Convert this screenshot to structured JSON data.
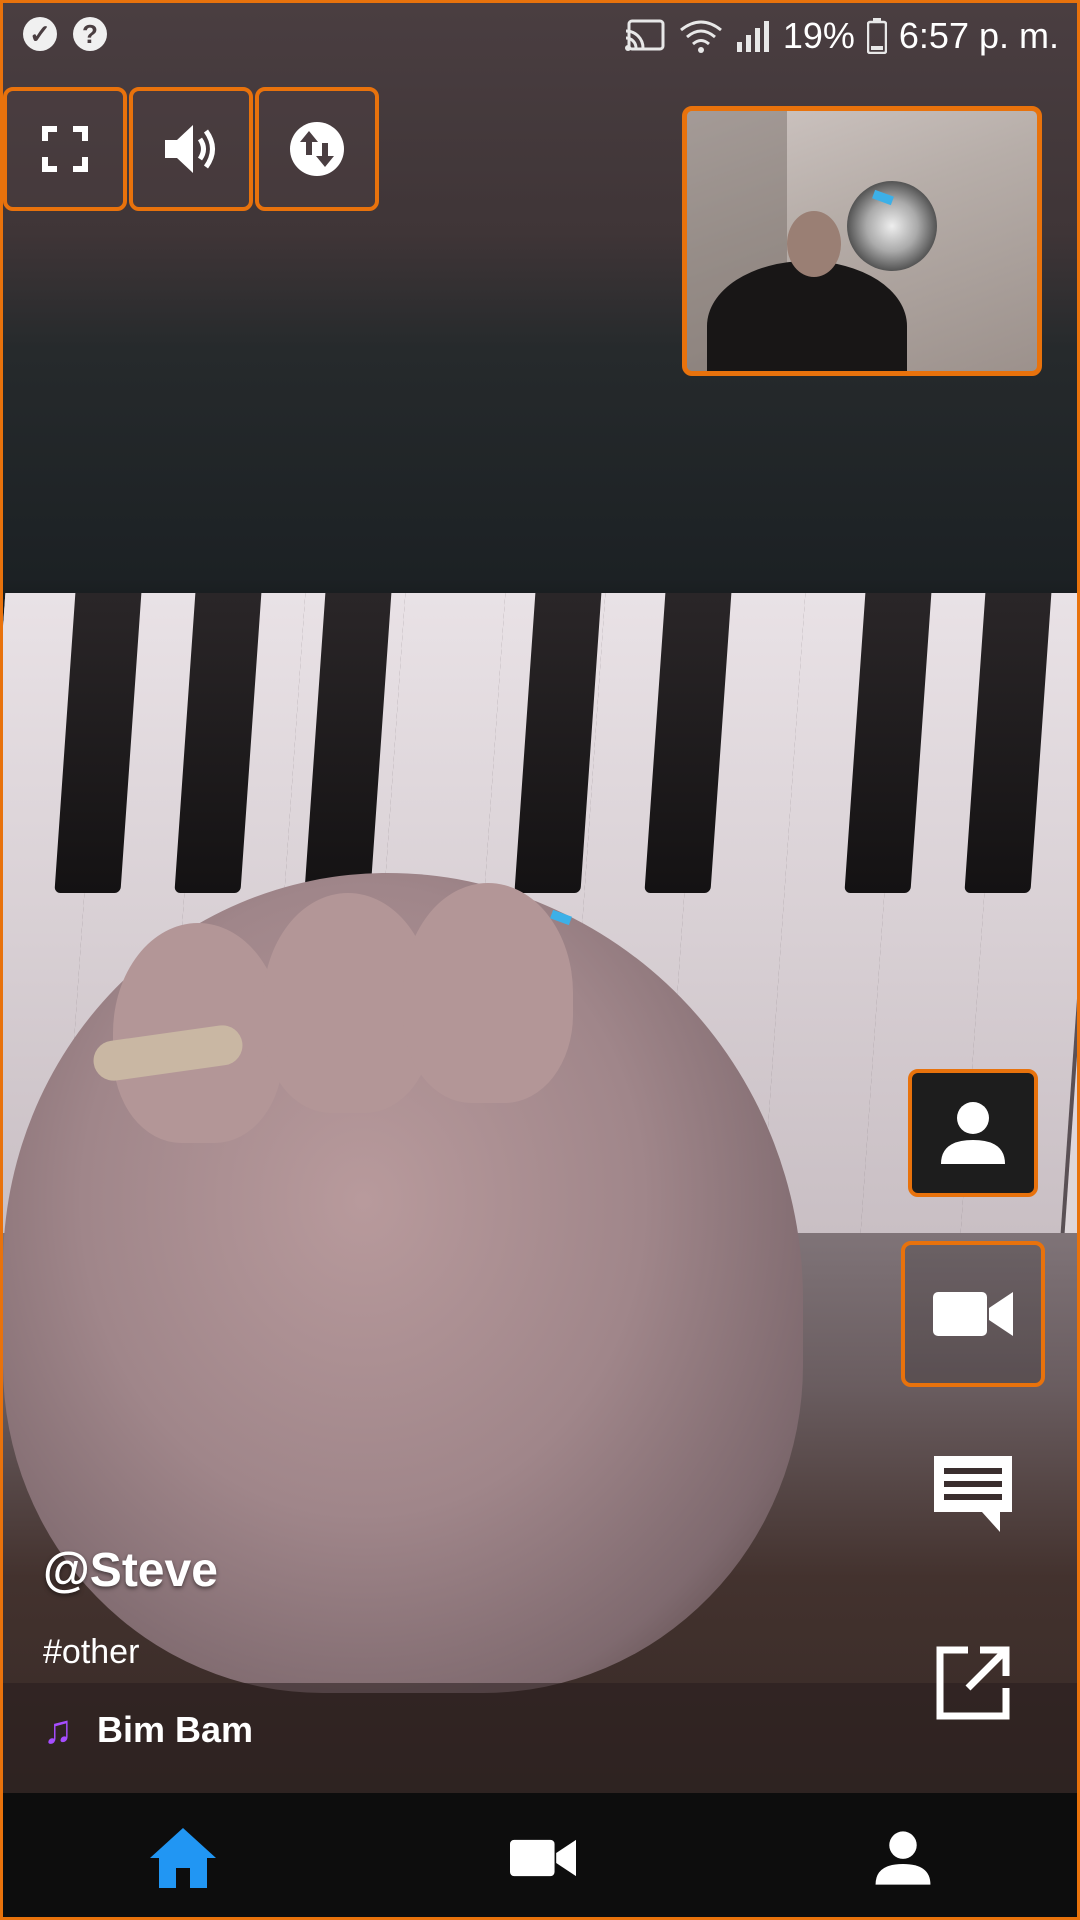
{
  "status_bar": {
    "icons_left": [
      "check-circle-icon",
      "help-circle-icon"
    ],
    "icons_right": [
      "cast-icon",
      "wifi-icon",
      "signal-icon",
      "battery-icon"
    ],
    "battery": "19%",
    "time": "6:57 p. m."
  },
  "controls": {
    "fullscreen_icon": "fullscreen-icon",
    "volume_icon": "volume-icon",
    "swap_icon": "swap-vertical-icon"
  },
  "pip": {
    "description_icon": "remote-video-thumbnail"
  },
  "actions": [
    {
      "icon": "person-icon"
    },
    {
      "icon": "video-camera-icon"
    },
    {
      "icon": "chat-icon"
    },
    {
      "icon": "open-external-icon"
    }
  ],
  "post": {
    "username": "@Steve",
    "hashtag": "#other",
    "song": "Bim Bam"
  },
  "bottom_nav": {
    "items": [
      {
        "icon": "home-icon",
        "active": true,
        "color": "#2196f3"
      },
      {
        "icon": "video-camera-icon",
        "active": false,
        "color": "#ffffff"
      },
      {
        "icon": "person-icon",
        "active": false,
        "color": "#ffffff"
      }
    ]
  },
  "colors": {
    "highlight_border": "#e8720c",
    "music_note": "#a64dff",
    "active_nav": "#2196f3"
  }
}
